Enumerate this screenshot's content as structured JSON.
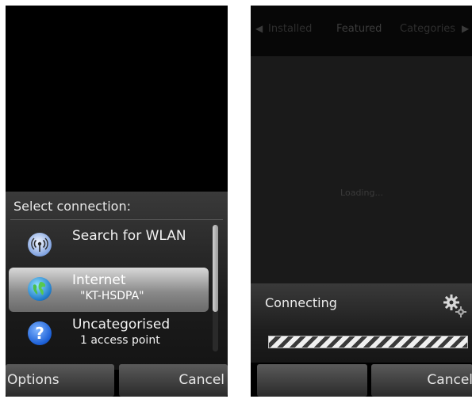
{
  "phone1": {
    "dialog_title": "Select connection:",
    "items": [
      {
        "icon": "wlan-search-icon",
        "line1": "Search for WLAN",
        "line2": ""
      },
      {
        "icon": "globe-icon",
        "line1": "Internet",
        "line2": "\"KT-HSDPA\""
      },
      {
        "icon": "help-icon",
        "line1": "Uncategorised",
        "line2": "1 access point"
      }
    ],
    "softkey_left": "Options",
    "softkey_right": "Cancel"
  },
  "phone2": {
    "tabs": [
      "Installed",
      "Featured",
      "Categories"
    ],
    "loading_text": "Loading...",
    "status_label": "Connecting",
    "softkey_left": "",
    "softkey_right": "Cancel"
  },
  "colors": {
    "background": "#000000",
    "dialog": "#2a2a2a",
    "selected_item": "#b0b0b0"
  }
}
